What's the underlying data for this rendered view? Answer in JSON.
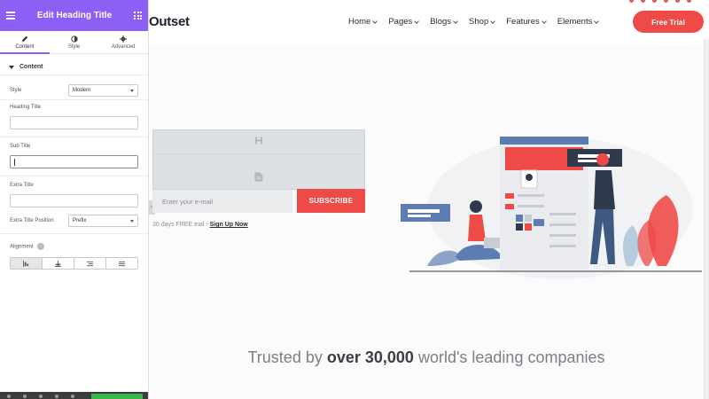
{
  "editor": {
    "title": "Edit Heading Title",
    "tabs": [
      {
        "label": "Content",
        "icon": "pencil-icon"
      },
      {
        "label": "Style",
        "icon": "contrast-icon"
      },
      {
        "label": "Advanced",
        "icon": "gear-icon"
      }
    ],
    "section_title": "Content",
    "style_label": "Style",
    "style_value": "Modern",
    "heading_title_label": "Heading Title",
    "heading_title_value": "",
    "sub_title_label": "Sub Title",
    "sub_title_value": "",
    "extra_title_label": "Extra Title",
    "extra_title_value": "",
    "extra_position_label": "Extra Title Position",
    "extra_position_value": "Prefix",
    "alignment_label": "Alignment",
    "alignment_options": [
      "left",
      "center",
      "right",
      "justify"
    ],
    "alignment_selected": "left",
    "accent": "#8c5ff5"
  },
  "site": {
    "logo": "Outset",
    "nav": [
      "Home",
      "Pages",
      "Blogs",
      "Shop",
      "Features",
      "Elements"
    ],
    "cta": "Free Trial",
    "email_placeholder": "Enter your e-mail",
    "subscribe": "SUBSCRIBE",
    "trial_note": "30 days FREE trial -",
    "trial_link": "Sign Up Now",
    "trusted_pre": "Trusted by",
    "trusted_bold": "over 30,000",
    "trusted_post": "world's leading companies",
    "brand_red": "#ee4b48"
  }
}
